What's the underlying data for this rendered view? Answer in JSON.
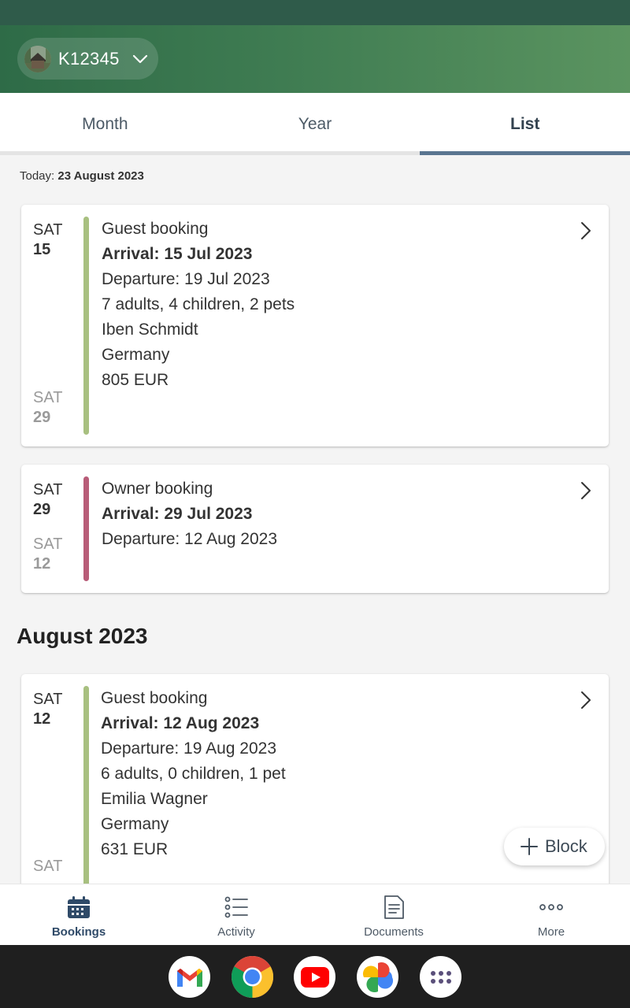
{
  "header": {
    "property_id": "K12345"
  },
  "tabs": [
    {
      "label": "Month"
    },
    {
      "label": "Year"
    },
    {
      "label": "List"
    }
  ],
  "today": {
    "label": "Today:",
    "date": "23 August 2023"
  },
  "bookings": [
    {
      "start_day": "SAT",
      "start_num": "15",
      "end_day": "SAT",
      "end_num": "29",
      "type": "Guest booking",
      "arrival": "Arrival: 15 Jul 2023",
      "departure": "Departure: 19 Jul 2023",
      "guests": "7 adults, 4 children, 2 pets",
      "name": "Iben Schmidt",
      "country": "Germany",
      "price": "805 EUR",
      "color": "#a8c080"
    },
    {
      "start_day": "SAT",
      "start_num": "29",
      "end_day": "SAT",
      "end_num": "12",
      "type": "Owner booking",
      "arrival": "Arrival: 29 Jul 2023",
      "departure": "Departure: 12 Aug 2023",
      "color": "#b85c78"
    },
    {
      "start_day": "SAT",
      "start_num": "12",
      "end_day": "SAT",
      "type": "Guest booking",
      "arrival": "Arrival: 12 Aug 2023",
      "departure": "Departure: 19 Aug 2023",
      "guests": "6 adults, 0 children, 1 pet",
      "name": "Emilia Wagner",
      "country": "Germany",
      "price": "631 EUR",
      "color": "#a8c080"
    }
  ],
  "section": {
    "month_title": "August 2023"
  },
  "fab": {
    "label": "Block"
  },
  "bottom_nav": [
    {
      "label": "Bookings",
      "icon": "calendar-icon"
    },
    {
      "label": "Activity",
      "icon": "list-icon"
    },
    {
      "label": "Documents",
      "icon": "document-icon"
    },
    {
      "label": "More",
      "icon": "more-icon"
    }
  ],
  "dock_apps": [
    "gmail-icon",
    "chrome-icon",
    "youtube-icon",
    "photos-icon",
    "app-drawer-icon"
  ],
  "colors": {
    "accent": "#5a7590",
    "header_green": "#3f7c52",
    "guest_bar": "#a8c080",
    "owner_bar": "#b85c78"
  }
}
